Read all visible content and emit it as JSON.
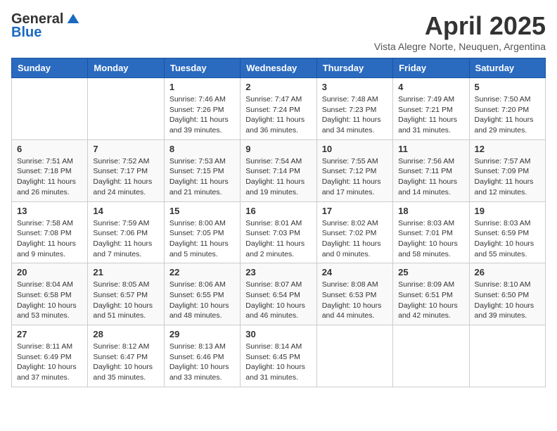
{
  "header": {
    "logo_general": "General",
    "logo_blue": "Blue",
    "title": "April 2025",
    "subtitle": "Vista Alegre Norte, Neuquen, Argentina"
  },
  "weekdays": [
    "Sunday",
    "Monday",
    "Tuesday",
    "Wednesday",
    "Thursday",
    "Friday",
    "Saturday"
  ],
  "weeks": [
    [
      {
        "day": "",
        "info": ""
      },
      {
        "day": "",
        "info": ""
      },
      {
        "day": "1",
        "info": "Sunrise: 7:46 AM\nSunset: 7:26 PM\nDaylight: 11 hours and 39 minutes."
      },
      {
        "day": "2",
        "info": "Sunrise: 7:47 AM\nSunset: 7:24 PM\nDaylight: 11 hours and 36 minutes."
      },
      {
        "day": "3",
        "info": "Sunrise: 7:48 AM\nSunset: 7:23 PM\nDaylight: 11 hours and 34 minutes."
      },
      {
        "day": "4",
        "info": "Sunrise: 7:49 AM\nSunset: 7:21 PM\nDaylight: 11 hours and 31 minutes."
      },
      {
        "day": "5",
        "info": "Sunrise: 7:50 AM\nSunset: 7:20 PM\nDaylight: 11 hours and 29 minutes."
      }
    ],
    [
      {
        "day": "6",
        "info": "Sunrise: 7:51 AM\nSunset: 7:18 PM\nDaylight: 11 hours and 26 minutes."
      },
      {
        "day": "7",
        "info": "Sunrise: 7:52 AM\nSunset: 7:17 PM\nDaylight: 11 hours and 24 minutes."
      },
      {
        "day": "8",
        "info": "Sunrise: 7:53 AM\nSunset: 7:15 PM\nDaylight: 11 hours and 21 minutes."
      },
      {
        "day": "9",
        "info": "Sunrise: 7:54 AM\nSunset: 7:14 PM\nDaylight: 11 hours and 19 minutes."
      },
      {
        "day": "10",
        "info": "Sunrise: 7:55 AM\nSunset: 7:12 PM\nDaylight: 11 hours and 17 minutes."
      },
      {
        "day": "11",
        "info": "Sunrise: 7:56 AM\nSunset: 7:11 PM\nDaylight: 11 hours and 14 minutes."
      },
      {
        "day": "12",
        "info": "Sunrise: 7:57 AM\nSunset: 7:09 PM\nDaylight: 11 hours and 12 minutes."
      }
    ],
    [
      {
        "day": "13",
        "info": "Sunrise: 7:58 AM\nSunset: 7:08 PM\nDaylight: 11 hours and 9 minutes."
      },
      {
        "day": "14",
        "info": "Sunrise: 7:59 AM\nSunset: 7:06 PM\nDaylight: 11 hours and 7 minutes."
      },
      {
        "day": "15",
        "info": "Sunrise: 8:00 AM\nSunset: 7:05 PM\nDaylight: 11 hours and 5 minutes."
      },
      {
        "day": "16",
        "info": "Sunrise: 8:01 AM\nSunset: 7:03 PM\nDaylight: 11 hours and 2 minutes."
      },
      {
        "day": "17",
        "info": "Sunrise: 8:02 AM\nSunset: 7:02 PM\nDaylight: 11 hours and 0 minutes."
      },
      {
        "day": "18",
        "info": "Sunrise: 8:03 AM\nSunset: 7:01 PM\nDaylight: 10 hours and 58 minutes."
      },
      {
        "day": "19",
        "info": "Sunrise: 8:03 AM\nSunset: 6:59 PM\nDaylight: 10 hours and 55 minutes."
      }
    ],
    [
      {
        "day": "20",
        "info": "Sunrise: 8:04 AM\nSunset: 6:58 PM\nDaylight: 10 hours and 53 minutes."
      },
      {
        "day": "21",
        "info": "Sunrise: 8:05 AM\nSunset: 6:57 PM\nDaylight: 10 hours and 51 minutes."
      },
      {
        "day": "22",
        "info": "Sunrise: 8:06 AM\nSunset: 6:55 PM\nDaylight: 10 hours and 48 minutes."
      },
      {
        "day": "23",
        "info": "Sunrise: 8:07 AM\nSunset: 6:54 PM\nDaylight: 10 hours and 46 minutes."
      },
      {
        "day": "24",
        "info": "Sunrise: 8:08 AM\nSunset: 6:53 PM\nDaylight: 10 hours and 44 minutes."
      },
      {
        "day": "25",
        "info": "Sunrise: 8:09 AM\nSunset: 6:51 PM\nDaylight: 10 hours and 42 minutes."
      },
      {
        "day": "26",
        "info": "Sunrise: 8:10 AM\nSunset: 6:50 PM\nDaylight: 10 hours and 39 minutes."
      }
    ],
    [
      {
        "day": "27",
        "info": "Sunrise: 8:11 AM\nSunset: 6:49 PM\nDaylight: 10 hours and 37 minutes."
      },
      {
        "day": "28",
        "info": "Sunrise: 8:12 AM\nSunset: 6:47 PM\nDaylight: 10 hours and 35 minutes."
      },
      {
        "day": "29",
        "info": "Sunrise: 8:13 AM\nSunset: 6:46 PM\nDaylight: 10 hours and 33 minutes."
      },
      {
        "day": "30",
        "info": "Sunrise: 8:14 AM\nSunset: 6:45 PM\nDaylight: 10 hours and 31 minutes."
      },
      {
        "day": "",
        "info": ""
      },
      {
        "day": "",
        "info": ""
      },
      {
        "day": "",
        "info": ""
      }
    ]
  ]
}
